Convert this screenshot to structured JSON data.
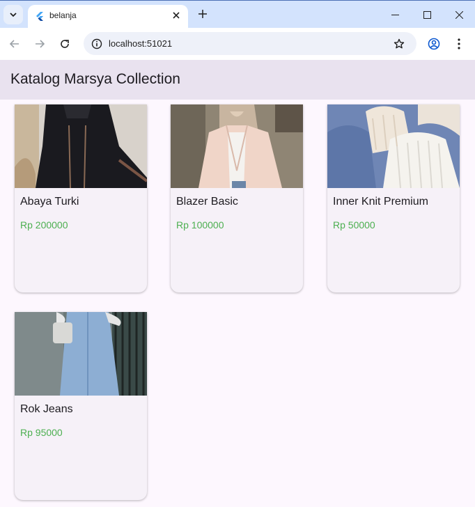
{
  "browser": {
    "tab_title": "belanja",
    "url": "localhost:51021"
  },
  "app": {
    "title": "Katalog Marsya Collection"
  },
  "products": [
    {
      "name": "Abaya Turki",
      "price": "Rp 200000"
    },
    {
      "name": "Blazer Basic",
      "price": "Rp 100000"
    },
    {
      "name": "Inner Knit Premium",
      "price": "Rp 50000"
    },
    {
      "name": "Rok Jeans",
      "price": "Rp 95000"
    }
  ],
  "colors": {
    "tabbar": "#d3e3fd",
    "appbar": "#e9e2ef",
    "background": "#fdf7fe",
    "card": "#f6f1f8",
    "price": "#4caf50"
  }
}
